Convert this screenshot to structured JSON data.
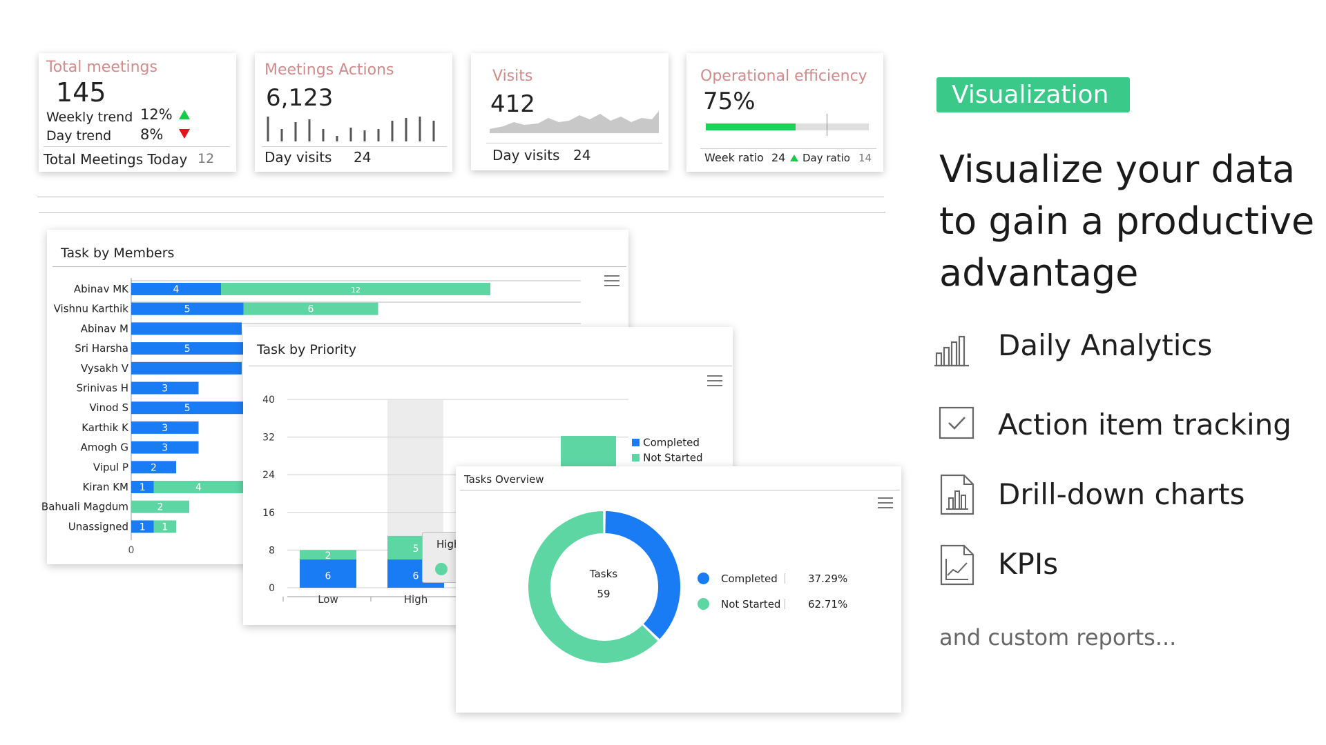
{
  "kpis": {
    "total_meetings": {
      "title": "Total meetings",
      "value": "145",
      "weekly_label": "Weekly trend",
      "weekly_value": "12%",
      "day_label": "Day trend",
      "day_value": "8%",
      "footer_label": "Total Meetings Today",
      "footer_value": "12"
    },
    "meeting_actions": {
      "title": "Meetings Actions",
      "value": "6,123",
      "footer_label": "Day visits",
      "footer_value": "24"
    },
    "visits": {
      "title": "Visits",
      "value": "412",
      "footer_label": "Day visits",
      "footer_value": "24"
    },
    "efficiency": {
      "title": "Operational efficiency",
      "value": "75%",
      "progress": 0.75,
      "week_label": "Week ratio",
      "week_value": "24",
      "day_label": "Day ratio",
      "day_value": "14"
    }
  },
  "colors": {
    "blue": "#1a7cf5",
    "green": "#5ed6a4",
    "accent": "#3bc98a",
    "kpi_title": "#d28a8a"
  },
  "members_chart": {
    "title": "Task by Members",
    "chart_data": {
      "type": "bar",
      "categories": [
        "Abinav MK",
        "Vishnu Karthik",
        "Abinav M",
        "Sri Harsha",
        "Vysakh V",
        "Srinivas H",
        "Vinod S",
        "Karthik K",
        "Amogh G",
        "Vipul P",
        "Kiran KM",
        "Bahuali Magdum",
        "Unassigned"
      ],
      "series": [
        {
          "name": "Completed",
          "values": [
            4,
            5,
            null,
            5,
            null,
            3,
            5,
            3,
            3,
            2,
            1,
            0,
            1
          ],
          "labels": [
            "4",
            "5",
            "",
            "5",
            "",
            "3",
            "5",
            "3",
            "3",
            "2",
            "1",
            "",
            "1"
          ]
        },
        {
          "name": "Not Started",
          "values": [
            12,
            6,
            null,
            null,
            null,
            null,
            null,
            null,
            null,
            null,
            4,
            2,
            1
          ],
          "labels": [
            "12",
            "6",
            "",
            "",
            "",
            "",
            "",
            "",
            "",
            "",
            "4",
            "2",
            "1"
          ]
        }
      ],
      "x_tick": "0"
    }
  },
  "priority_chart": {
    "title": "Task by Priority",
    "chart_data": {
      "type": "bar",
      "categories": [
        "Low",
        "High"
      ],
      "series": [
        {
          "name": "Completed",
          "values": [
            6,
            6
          ]
        },
        {
          "name": "Not Started",
          "values": [
            2,
            5
          ]
        }
      ],
      "yticks": [
        "0",
        "8",
        "16",
        "24",
        "32",
        "40"
      ],
      "ylim": [
        0,
        40
      ]
    },
    "legend": [
      "Completed",
      "Not Started"
    ],
    "tooltip_label": "High"
  },
  "overview_chart": {
    "title": "Tasks Overview",
    "chart_data": {
      "type": "pie",
      "labels": [
        "Completed",
        "Not Started"
      ],
      "values": [
        37.29,
        62.71
      ],
      "percent_labels": [
        "37.29%",
        "62.71%"
      ],
      "center_label": "Tasks",
      "center_value": "59"
    }
  },
  "promo": {
    "badge": "Visualization",
    "headline": [
      "Visualize your data",
      "to gain a productive",
      "advantage"
    ],
    "features": [
      {
        "label": "Daily Analytics",
        "icon": "bar-chart-icon"
      },
      {
        "label": "Action item tracking",
        "icon": "checkbox-icon"
      },
      {
        "label": "Drill-down charts",
        "icon": "document-chart-icon"
      },
      {
        "label": "KPIs",
        "icon": "document-line-chart-icon"
      }
    ],
    "footer": "and custom reports..."
  }
}
